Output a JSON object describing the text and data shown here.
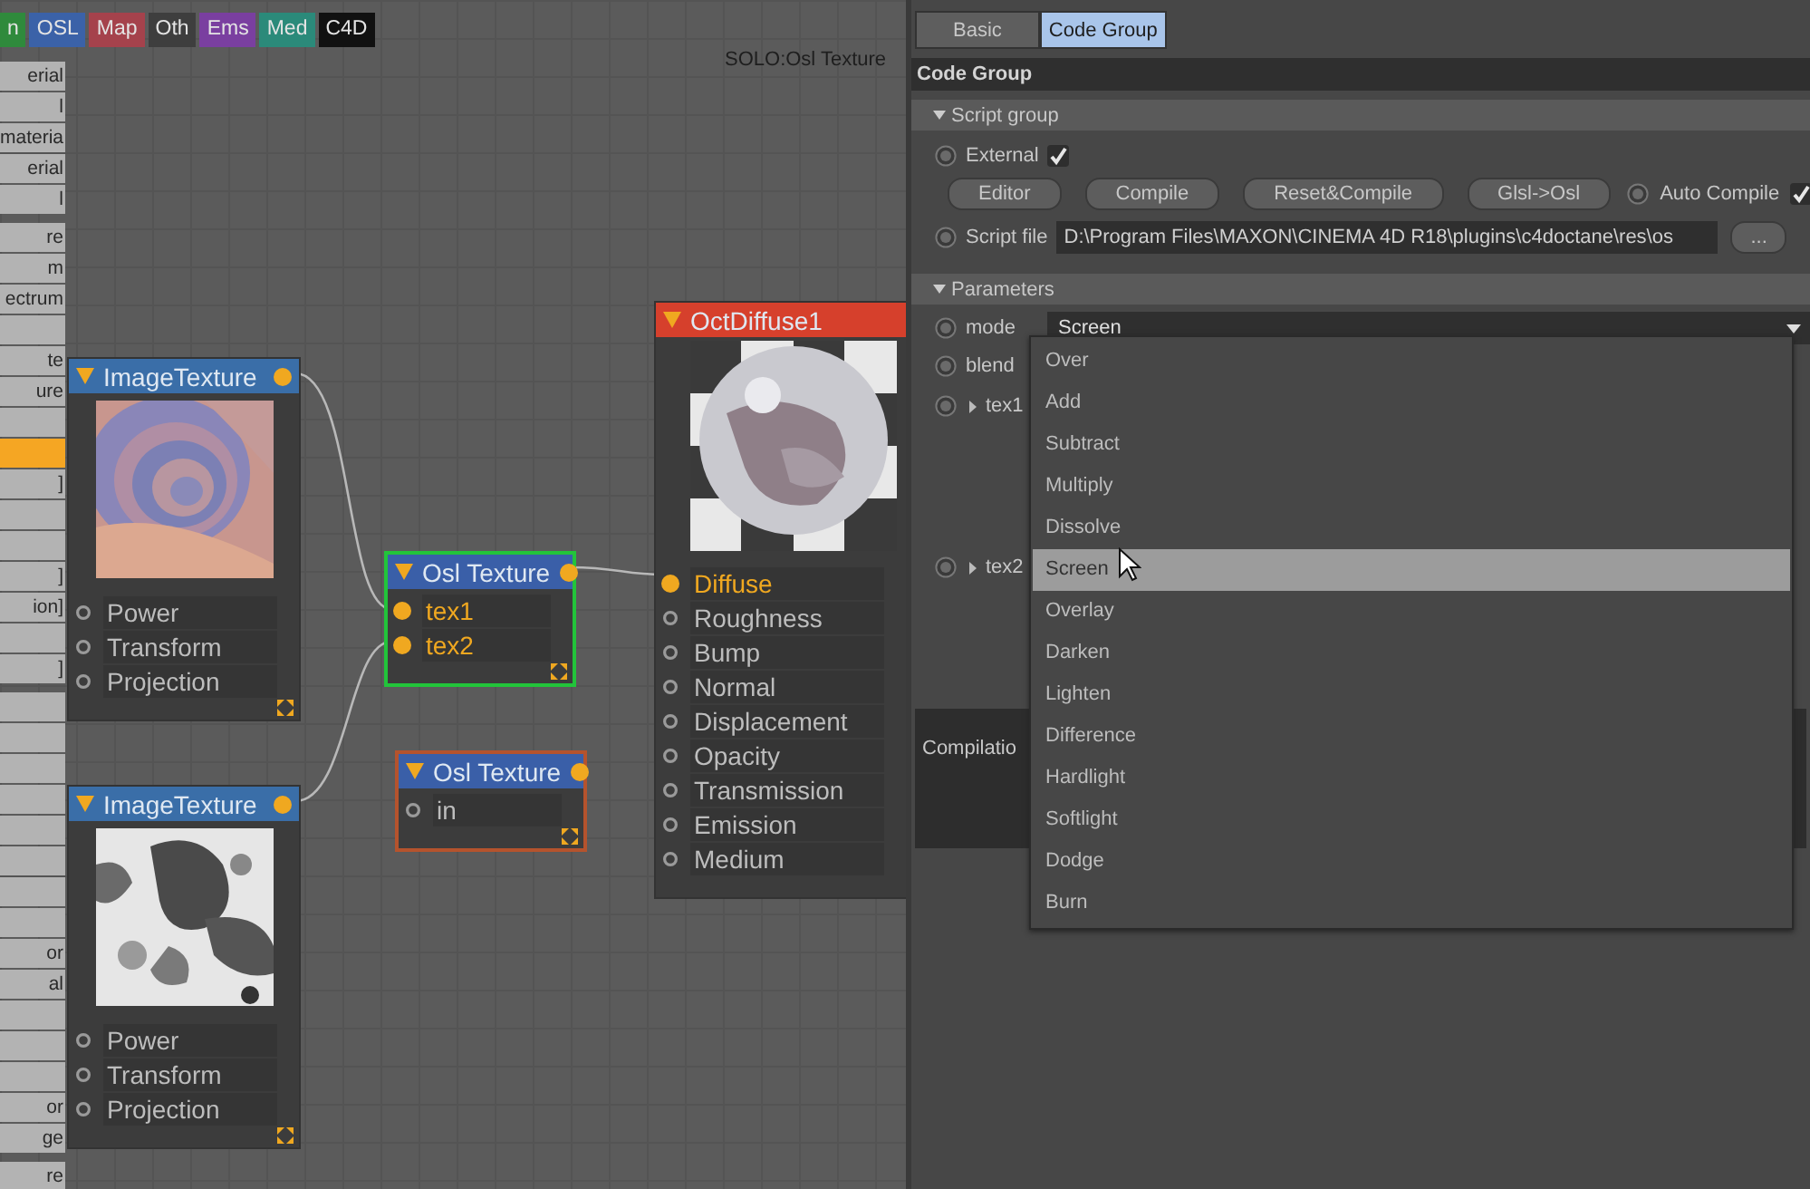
{
  "category_tabs": [
    {
      "label": "n",
      "color": "#2f8a3c"
    },
    {
      "label": "OSL",
      "color": "#3b62a8"
    },
    {
      "label": "Map",
      "color": "#a5424c"
    },
    {
      "label": "Oth",
      "color": "#3e3e3e"
    },
    {
      "label": "Ems",
      "color": "#7a3fa0"
    },
    {
      "label": "Med",
      "color": "#2b8a7a"
    },
    {
      "label": "C4D",
      "color": "#111111"
    }
  ],
  "sidebar": {
    "groups": [
      {
        "items": [
          {
            "label": "erial",
            "selected": false
          },
          {
            "label": "l",
            "selected": false
          },
          {
            "label": "materia",
            "selected": false
          },
          {
            "label": "erial",
            "selected": false
          },
          {
            "label": "l",
            "selected": false
          }
        ]
      },
      {
        "items": [
          {
            "label": "re",
            "selected": false
          },
          {
            "label": "m",
            "selected": false
          },
          {
            "label": "ectrum",
            "selected": false
          },
          {
            "selected": false
          },
          {
            "label": "te",
            "selected": false
          },
          {
            "label": "ure",
            "selected": false
          },
          {
            "selected": false
          },
          {
            "selected": true
          },
          {
            "label": "]",
            "selected": false
          },
          {
            "selected": false
          },
          {
            "selected": false
          },
          {
            "label": "]",
            "selected": false
          },
          {
            "label": "ion]",
            "selected": false
          },
          {
            "selected": false
          },
          {
            "label": "]",
            "selected": false
          }
        ]
      },
      {
        "items": [
          {
            "selected": false
          },
          {
            "selected": false
          },
          {
            "selected": false
          },
          {
            "selected": false
          },
          {
            "selected": false
          },
          {
            "selected": false
          },
          {
            "selected": false
          },
          {
            "selected": false
          },
          {
            "label": "or",
            "selected": false
          },
          {
            "label": "al",
            "selected": false
          },
          {
            "selected": false
          },
          {
            "selected": false
          },
          {
            "selected": false
          },
          {
            "label": "or",
            "selected": false
          },
          {
            "label": "ge",
            "selected": false
          }
        ]
      },
      {
        "items": [
          {
            "label": "re",
            "selected": false
          }
        ]
      }
    ]
  },
  "canvas_label": "SOLO:Osl Texture",
  "nodes": [
    {
      "title": "ImageTexture",
      "color": "#3a6ea8",
      "selected": false,
      "warning": false,
      "output": true,
      "resize_handle": true,
      "preview": {
        "kind": "picture"
      },
      "ports": [
        {
          "label": "Power",
          "connected": false
        },
        {
          "label": "Transform",
          "connected": false
        },
        {
          "label": "Projection",
          "connected": false
        }
      ]
    },
    {
      "title": "ImageTexture",
      "color": "#3a6ea8",
      "selected": false,
      "warning": false,
      "output": true,
      "resize_handle": true,
      "preview": {
        "kind": "picture"
      },
      "ports": [
        {
          "label": "Power",
          "connected": false
        },
        {
          "label": "Transform",
          "connected": false
        },
        {
          "label": "Projection",
          "connected": false
        }
      ]
    },
    {
      "title": "Osl Texture",
      "color": "#3a5fa8",
      "selected": true,
      "warning": false,
      "output": true,
      "resize_handle": true,
      "ports": [
        {
          "label": "tex1",
          "connected": true
        },
        {
          "label": "tex2",
          "connected": true
        }
      ]
    },
    {
      "title": "Osl Texture",
      "color": "#3a5fa8",
      "selected": false,
      "warning": true,
      "output": true,
      "resize_handle": true,
      "ports": [
        {
          "label": "in",
          "connected": false
        }
      ]
    },
    {
      "title": "OctDiffuse1",
      "color": "#d6402c",
      "selected": false,
      "warning": false,
      "preview": {
        "kind": "picture"
      },
      "ports": [
        {
          "label": "Diffuse",
          "connected": true
        },
        {
          "label": "Roughness",
          "connected": false
        },
        {
          "label": "Bump",
          "connected": false
        },
        {
          "label": "Normal",
          "connected": false
        },
        {
          "label": "Displacement",
          "connected": false
        },
        {
          "label": "Opacity",
          "connected": false
        },
        {
          "label": "Transmission",
          "connected": false
        },
        {
          "label": "Emission",
          "connected": false
        },
        {
          "label": "Medium",
          "connected": false
        }
      ]
    }
  ],
  "panel": {
    "tabs": [
      {
        "label": "Basic",
        "selected": false
      },
      {
        "label": "Code Group",
        "selected": true
      }
    ],
    "title": "Code Group",
    "script_group": {
      "title": "Script group",
      "expanded": true,
      "external": {
        "label": "External",
        "checked": true
      },
      "buttons": [
        "Editor",
        "Compile",
        "Reset&Compile",
        "Glsl->Osl"
      ],
      "auto_compile": {
        "label": "Auto Compile",
        "checked": true
      },
      "script_file": {
        "label": "Script file",
        "value": "D:\\Program Files\\MAXON\\CINEMA 4D R18\\plugins\\c4doctane\\res\\os",
        "browse": "..."
      }
    },
    "parameters": {
      "title": "Parameters",
      "expanded": true,
      "mode": {
        "label": "mode",
        "value": "Screen"
      },
      "rows": [
        {
          "label": "blend",
          "kind": "plain"
        },
        {
          "label": "tex1",
          "kind": "link"
        },
        {
          "label": "tex2",
          "kind": "link"
        }
      ],
      "compilation": "Compilatio"
    },
    "dropdown": {
      "options": [
        {
          "label": "Over",
          "selected": false
        },
        {
          "label": "Add",
          "selected": false
        },
        {
          "label": "Subtract",
          "selected": false
        },
        {
          "label": "Multiply",
          "selected": false
        },
        {
          "label": "Dissolve",
          "selected": false
        },
        {
          "label": "Screen",
          "selected": true
        },
        {
          "label": "Overlay",
          "selected": false
        },
        {
          "label": "Darken",
          "selected": false
        },
        {
          "label": "Lighten",
          "selected": false
        },
        {
          "label": "Difference",
          "selected": false
        },
        {
          "label": "Hardlight",
          "selected": false
        },
        {
          "label": "Softlight",
          "selected": false
        },
        {
          "label": "Dodge",
          "selected": false
        },
        {
          "label": "Burn",
          "selected": false
        }
      ]
    }
  }
}
